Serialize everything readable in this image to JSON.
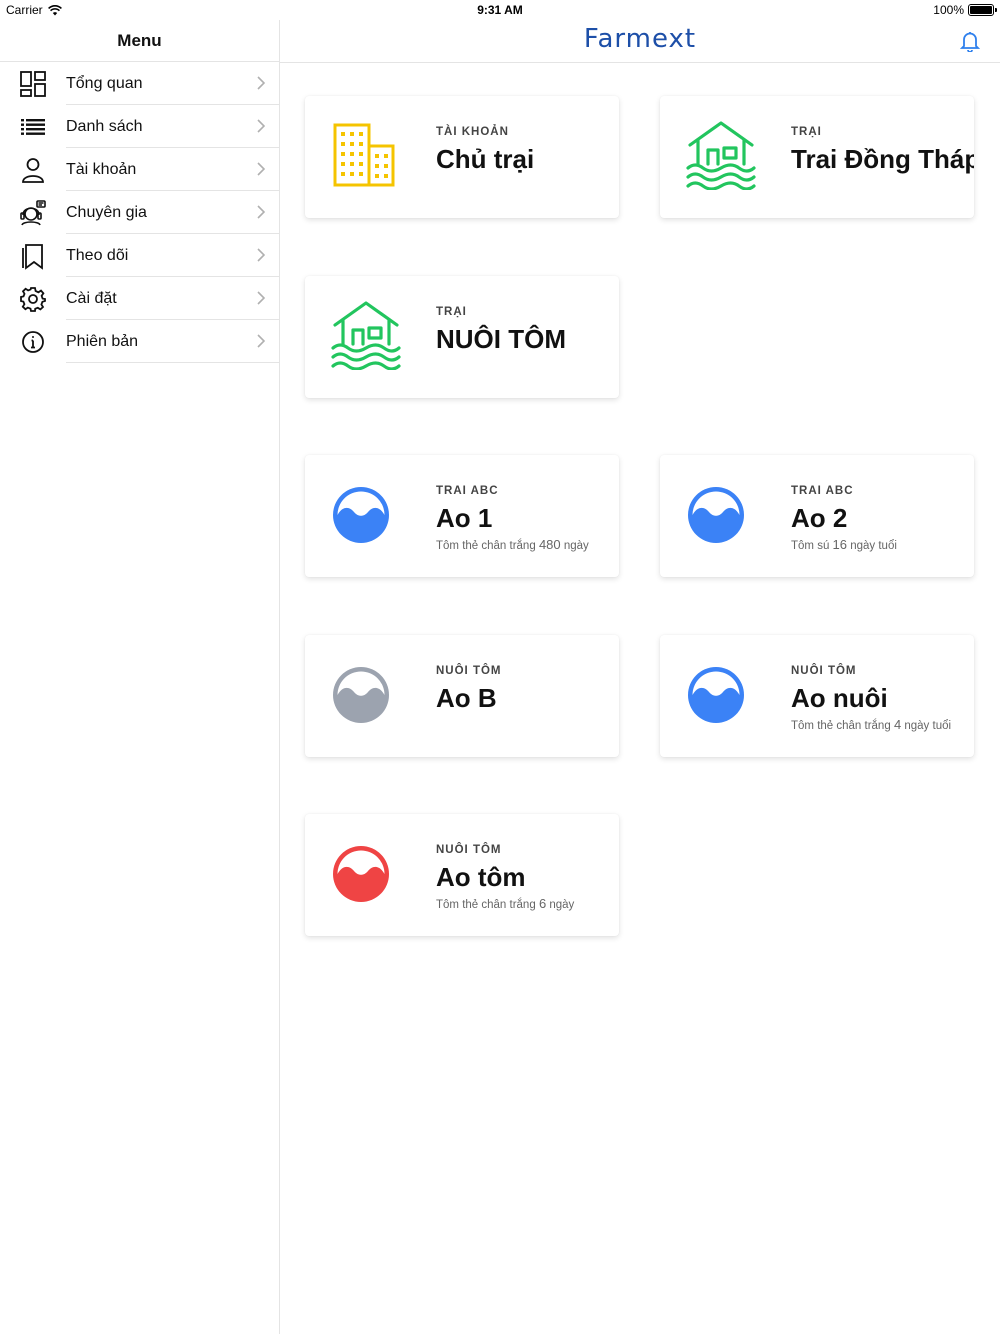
{
  "status_bar": {
    "carrier": "Carrier",
    "time": "9:31 AM",
    "battery": "100%"
  },
  "sidebar": {
    "title": "Menu",
    "items": [
      {
        "label": "Tổng quan",
        "icon": "dashboard-icon"
      },
      {
        "label": "Danh sách",
        "icon": "list-icon"
      },
      {
        "label": "Tài khoản",
        "icon": "user-icon"
      },
      {
        "label": "Chuyên gia",
        "icon": "support-agent-icon"
      },
      {
        "label": "Theo dõi",
        "icon": "bookmark-icon"
      },
      {
        "label": "Cài đặt",
        "icon": "gear-icon"
      },
      {
        "label": "Phiên bản",
        "icon": "info-icon"
      }
    ]
  },
  "header": {
    "brand": "Farmext",
    "brand_color": "#1d4fa8",
    "bell_color": "#2f80ed"
  },
  "cards": [
    {
      "overline": "TÀI KHOẢN",
      "title": "Chủ trại",
      "icon": "building-icon",
      "color": "#f5c400"
    },
    {
      "overline": "TRẠI",
      "title": "Trai Đồng Tháp",
      "icon": "farm-house-icon",
      "color": "#22c55e"
    },
    {
      "overline": "TRẠI",
      "title": "NUÔI TÔM",
      "icon": "farm-house-icon",
      "color": "#22c55e"
    },
    {
      "overline": "TRAI ABC",
      "title": "Ao 1",
      "sub_pre": "Tôm thẻ chân trắng",
      "sub_num": "480",
      "sub_post": "ngày",
      "icon": "pond-icon",
      "color": "#3b82f6"
    },
    {
      "overline": "TRAI ABC",
      "title": "Ao 2",
      "sub_pre": "Tôm sú",
      "sub_num": "16",
      "sub_post": "ngày tuổi",
      "icon": "pond-icon",
      "color": "#3b82f6"
    },
    {
      "overline": "NUÔI TÔM",
      "title": "Ao B",
      "icon": "pond-icon",
      "color": "#9ca3af"
    },
    {
      "overline": "NUÔI TÔM",
      "title": "Ao nuôi",
      "sub_pre": "Tôm thẻ chân trắng",
      "sub_num": "4",
      "sub_post": "ngày tuổi",
      "icon": "pond-icon",
      "color": "#3b82f6"
    },
    {
      "overline": "NUÔI TÔM",
      "title": "Ao tôm",
      "sub_pre": "Tôm thẻ chân trắng",
      "sub_num": "6",
      "sub_post": "ngày",
      "icon": "pond-icon",
      "color": "#ef4444"
    }
  ]
}
